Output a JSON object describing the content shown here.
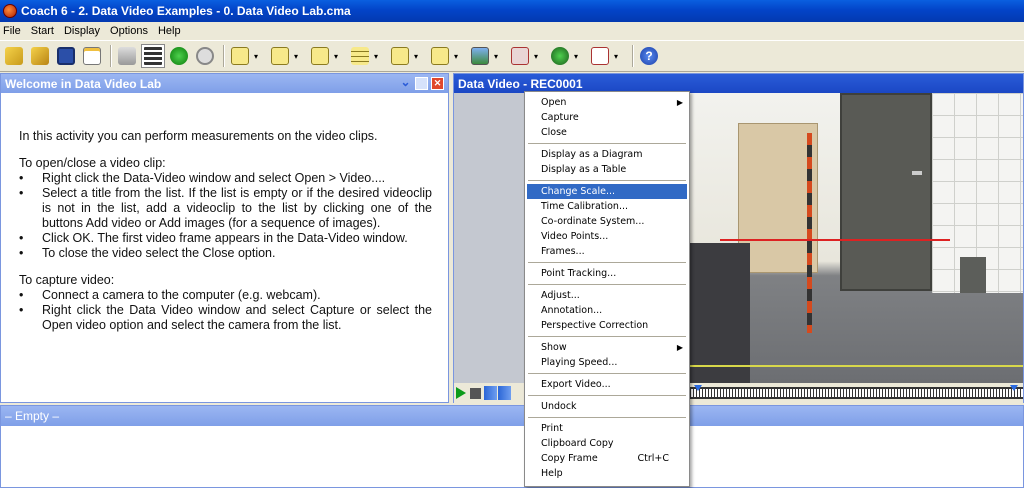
{
  "window": {
    "title": "Coach 6 - 2. Data Video Examples - 0. Data Video Lab.cma"
  },
  "menubar": [
    "File",
    "Start",
    "Display",
    "Options",
    "Help"
  ],
  "toolbar": {
    "icons": [
      "open-folder-icon",
      "folder-icon",
      "save-icon",
      "new-window-icon",
      "print-icon",
      "film-icon",
      "play-icon",
      "reset-icon",
      "meter-icon",
      "value-display-icon",
      "graph-icon",
      "table-icon",
      "chart-icon",
      "list-icon",
      "image-icon",
      "video-icon",
      "sensor-icon",
      "text-icon",
      "help-icon"
    ]
  },
  "left_panel": {
    "title": "Welcome in Data Video Lab",
    "intro": "In this activity you can perform measurements on the video clips.",
    "open_heading": "To open/close a video clip:",
    "open_steps": [
      "Right click the Data-Video window and select Open > Video....",
      "Select a title from the list. If the list is empty or if the desired videoclip is not in the list, add a videoclip to the list by clicking one of the buttons Add video or Add images (for a sequence of images).",
      "Click OK. The first video frame appears in the Data-Video window.",
      "To close the video select the Close option."
    ],
    "capture_heading": "To capture video:",
    "capture_steps": [
      "Connect a camera to the computer (e.g. webcam).",
      "Right click the Data Video window and select Capture or select the Open video option and select the camera from the list."
    ]
  },
  "right_panel": {
    "title": "Data Video - REC0001"
  },
  "bottom_panel": {
    "title": "– Empty –"
  },
  "context_menu": {
    "groups": [
      [
        {
          "label": "Open",
          "submenu": true
        },
        {
          "label": "Capture"
        },
        {
          "label": "Close"
        }
      ],
      [
        {
          "label": "Display as a Diagram"
        },
        {
          "label": "Display as a Table"
        }
      ],
      [
        {
          "label": "Change Scale...",
          "highlighted": true
        },
        {
          "label": "Time Calibration..."
        },
        {
          "label": "Co-ordinate System..."
        },
        {
          "label": "Video Points..."
        },
        {
          "label": "Frames..."
        }
      ],
      [
        {
          "label": "Point Tracking..."
        }
      ],
      [
        {
          "label": "Adjust..."
        },
        {
          "label": "Annotation..."
        },
        {
          "label": "Perspective Correction"
        }
      ],
      [
        {
          "label": "Show",
          "submenu": true
        },
        {
          "label": "Playing Speed..."
        }
      ],
      [
        {
          "label": "Export Video..."
        }
      ],
      [
        {
          "label": "Undock"
        }
      ],
      [
        {
          "label": "Print"
        },
        {
          "label": "Clipboard Copy"
        },
        {
          "label": "Copy Frame",
          "shortcut": "Ctrl+C"
        },
        {
          "label": "Help"
        }
      ]
    ]
  },
  "colors": {
    "title_blue": "#0344c8",
    "panel_head_light": "#8faaf0",
    "highlight": "#316ac5"
  }
}
